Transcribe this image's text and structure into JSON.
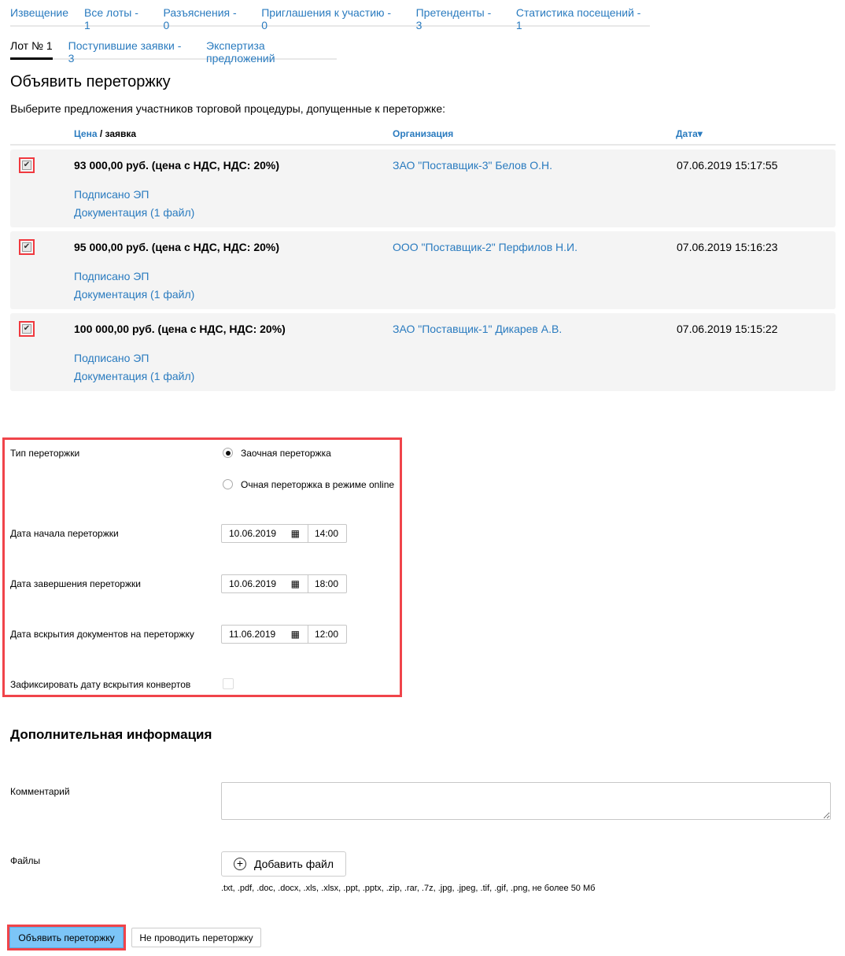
{
  "nav": {
    "tabs": [
      "Извещение",
      "Все лоты - 1",
      "Разъяснения - 0",
      "Приглашения к участию - 0",
      "Претенденты - 3",
      "Статистика посещений - 1"
    ]
  },
  "subnav": {
    "tabs": [
      "Лот № 1",
      "Поступившие заявки - 3",
      "Экспертиза предложений"
    ]
  },
  "title": "Объявить переторжку",
  "intro": "Выберите предложения участников торговой процедуры, допущенные к переторжке:",
  "table": {
    "col_price": "Цена",
    "col_sep": " / заявка",
    "col_org": "Организация",
    "col_date": "Дата",
    "sort_icon": "▾",
    "rows": [
      {
        "checked": true,
        "price": "93 000,00 руб. (цена с НДС, НДС: 20%)",
        "org": "ЗАО \"Поставщик-3\" Белов О.Н.",
        "date": "07.06.2019 15:17:55",
        "signed": "Подписано ЭП",
        "docs": "Документация (1 файл)"
      },
      {
        "checked": true,
        "price": "95 000,00 руб. (цена с НДС, НДС: 20%)",
        "org": "ООО \"Поставщик-2\" Перфилов Н.И.",
        "date": "07.06.2019 15:16:23",
        "signed": "Подписано ЭП",
        "docs": "Документация (1 файл)"
      },
      {
        "checked": true,
        "price": "100 000,00 руб. (цена с НДС, НДС: 20%)",
        "org": "ЗАО \"Поставщик-1\" Дикарев А.В.",
        "date": "07.06.2019 15:15:22",
        "signed": "Подписано ЭП",
        "docs": "Документация (1 файл)"
      }
    ]
  },
  "form": {
    "type_label": "Тип переторжки",
    "radio1": "Заочная переторжка",
    "radio2": "Очная переторжка в режиме online",
    "selected": "Заочная переторжка",
    "start_label": "Дата начала переторжки",
    "start_date": "10.06.2019",
    "start_time": "14:00",
    "end_label": "Дата завершения переторжки",
    "end_date": "10.06.2019",
    "end_time": "18:00",
    "open_label": "Дата вскрытия документов на переторжку",
    "open_date": "11.06.2019",
    "open_time": "12:00",
    "fix_label": "Зафиксировать дату вскрытия конвертов",
    "fix_checked": false
  },
  "extra": {
    "title": "Дополнительная информация",
    "comment_label": "Комментарий",
    "comment_value": "",
    "files_label": "Файлы",
    "add_file": "Добавить файл",
    "extensions": ".txt, .pdf, .doc, .docx, .xls, .xlsx, .ppt, .pptx, .zip, .rar, .7z, .jpg, .jpeg, .tif, .gif, .png, не более 50 Мб"
  },
  "actions": {
    "submit": "Объявить переторжку",
    "cancel": "Не проводить переторжку"
  },
  "colors": {
    "link": "#2a7bbf",
    "highlight": "#f0444a",
    "primary": "#7cc5f7"
  }
}
